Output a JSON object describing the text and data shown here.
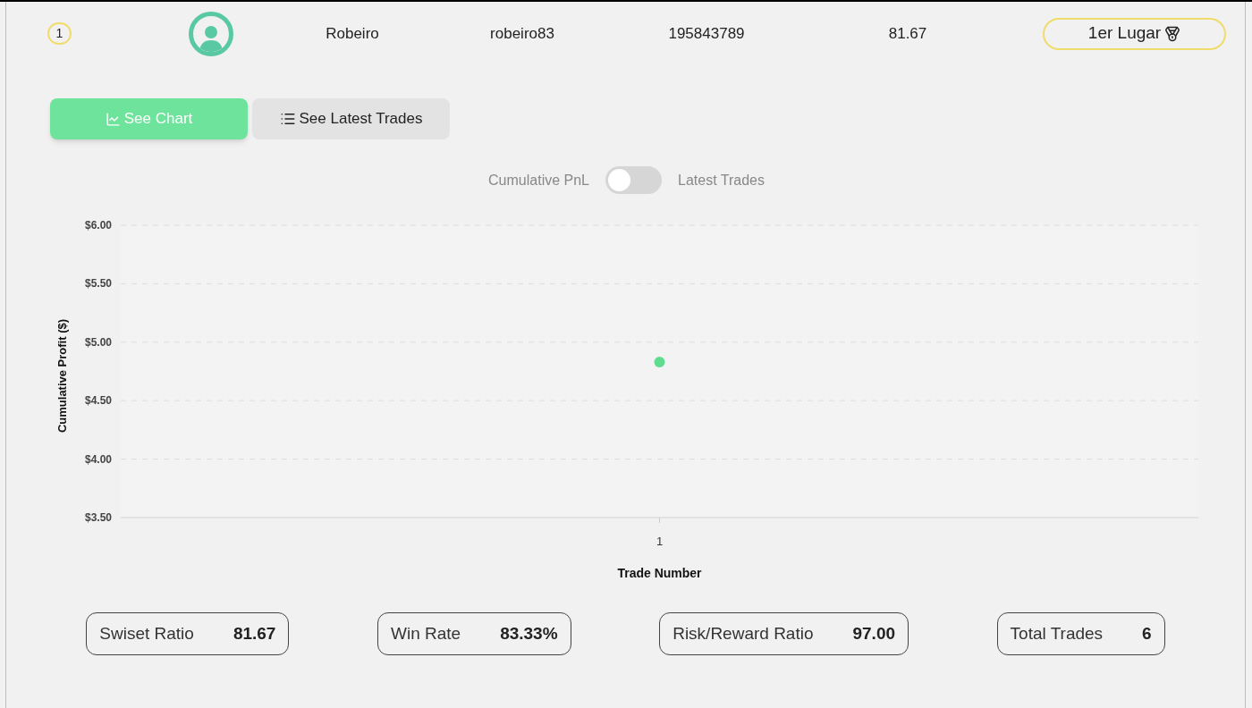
{
  "entry": {
    "rank": "1",
    "name": "Robeiro",
    "username": "robeiro83",
    "account": "195843789",
    "score": "81.67",
    "badge": "1er Lugar"
  },
  "tabs": [
    {
      "label": "See Chart",
      "selected": true,
      "kind": "chart"
    },
    {
      "label": "See Latest Trades",
      "selected": false,
      "kind": "list"
    }
  ],
  "toggle": {
    "left_label": "Cumulative PnL",
    "right_label": "Latest Trades",
    "on": false
  },
  "chart_data": {
    "type": "scatter",
    "xlabel": "Trade Number",
    "ylabel": "Cumulative Profit ($)",
    "categories": [
      "1"
    ],
    "series": [
      {
        "color": "#5fdc8f",
        "values": [
          4.83
        ]
      }
    ],
    "grid": true,
    "ylim": [
      3.5,
      6
    ],
    "yticks": [
      {
        "value": 3.5,
        "label": "$3.50"
      },
      {
        "value": 4,
        "label": "$4.00"
      },
      {
        "value": 4.5,
        "label": "$4.50"
      },
      {
        "value": 5,
        "label": "$5.00"
      },
      {
        "value": 5.5,
        "label": "$5.50"
      },
      {
        "value": 6,
        "label": "$6.00"
      }
    ]
  },
  "stats": [
    {
      "label": "Swiset Ratio",
      "value": "81.67"
    },
    {
      "label": "Win Rate",
      "value": "83.33%"
    },
    {
      "label": "Risk/Reward Ratio",
      "value": "97.00"
    },
    {
      "label": "Total Trades",
      "value": "6"
    }
  ]
}
